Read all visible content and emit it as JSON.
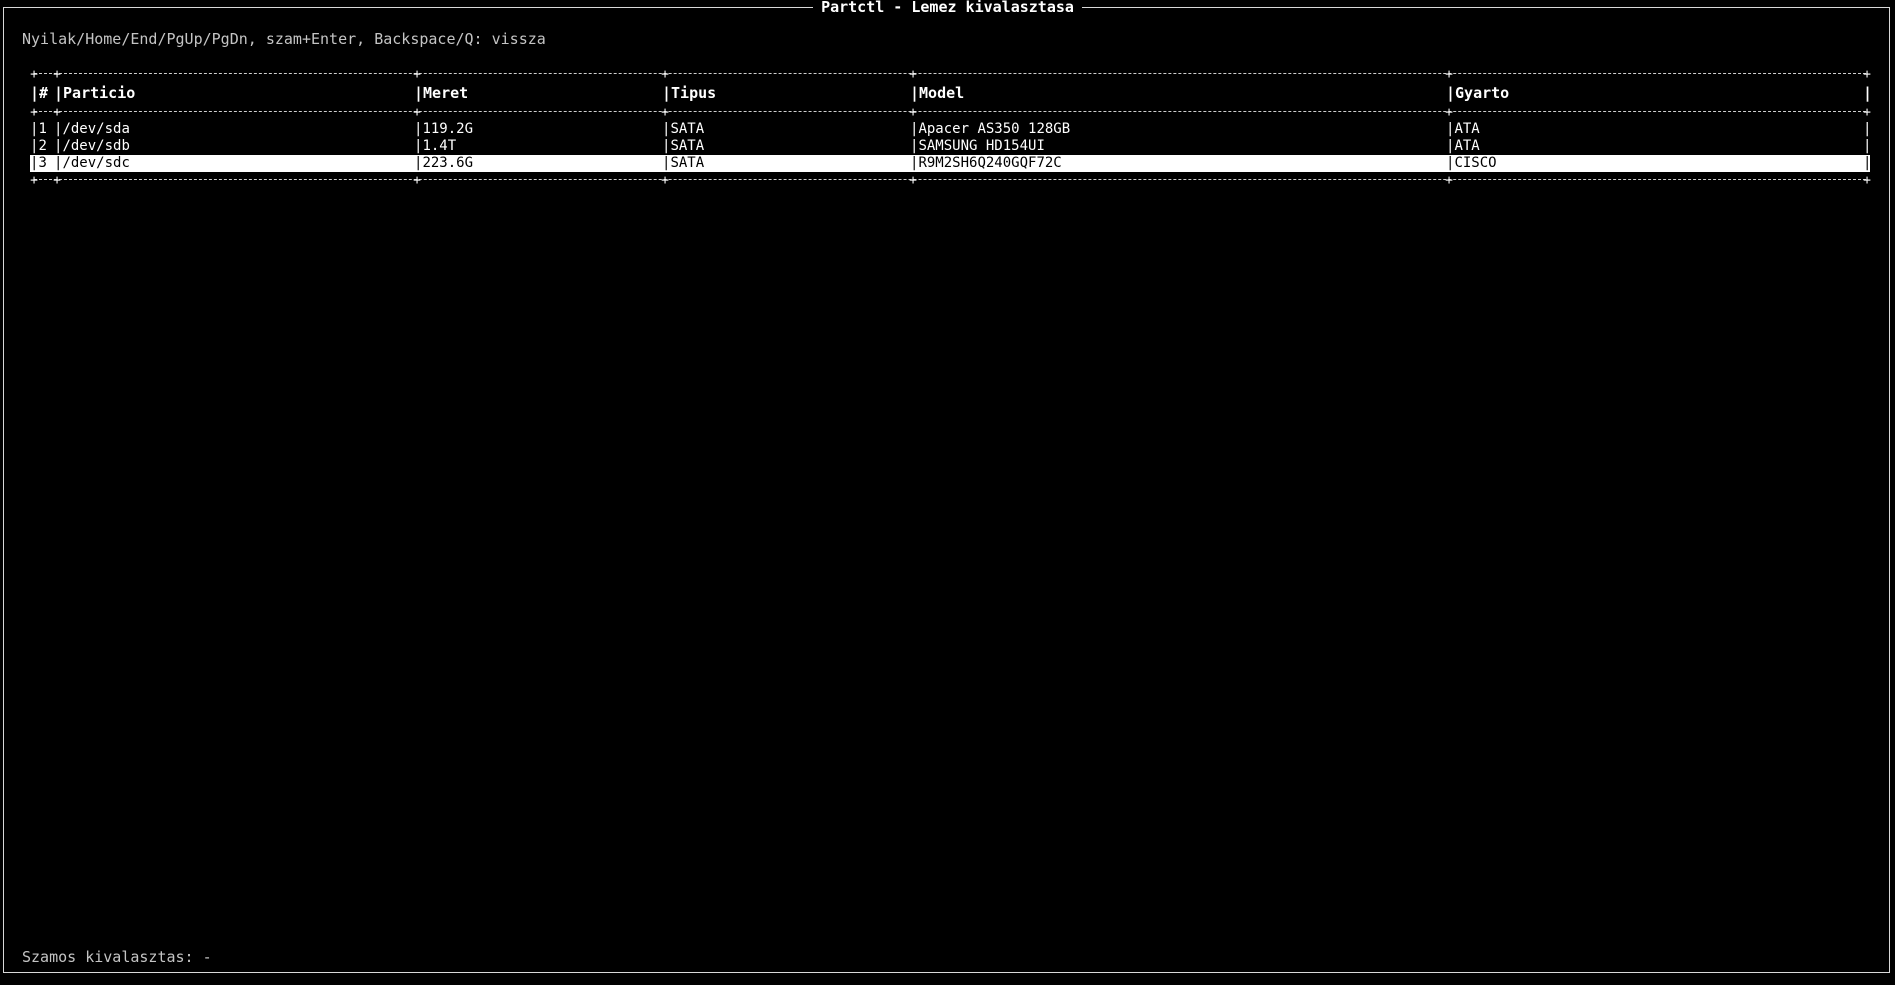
{
  "window": {
    "title": "Partctl - Lemez kivalasztasa"
  },
  "hint_text": "Nyilak/Home/End/PgUp/PgDn, szam+Enter, Backspace/Q: vissza",
  "table": {
    "headers": [
      "#",
      "Particio",
      "Meret",
      "Tipus",
      "Model",
      "Gyarto"
    ],
    "rows": [
      {
        "num": "1",
        "device": "/dev/sda",
        "size": "119.2G",
        "type": "SATA",
        "model": "Apacer AS350 128GB",
        "vendor": "ATA"
      },
      {
        "num": "2",
        "device": "/dev/sdb",
        "size": "1.4T",
        "type": "SATA",
        "model": "SAMSUNG HD154UI",
        "vendor": "ATA"
      },
      {
        "num": "3",
        "device": "/dev/sdc",
        "size": "223.6G",
        "type": "SATA",
        "model": "R9M2SH6Q240GQF72C",
        "vendor": "CISCO"
      }
    ],
    "selected_row": 3
  },
  "footer_text": "Szamos kivalasztas: -"
}
